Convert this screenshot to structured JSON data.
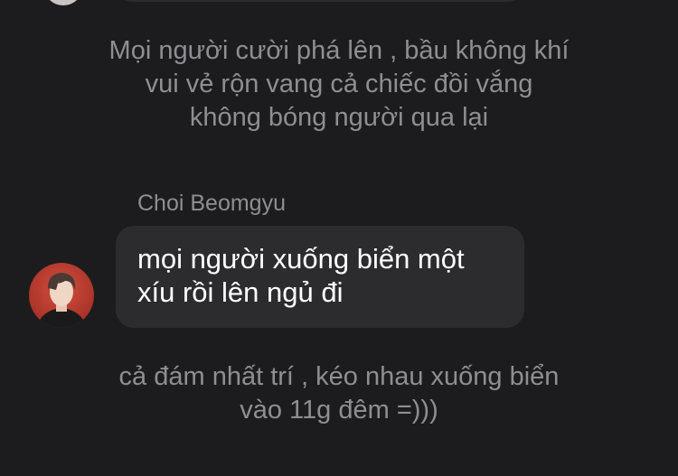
{
  "chat": {
    "narration_1": "Mọi người cười phá lên , bầu không khí\nvui vẻ rộn vang cả chiếc đồi vắng\nkhông bóng người qua lại",
    "message": {
      "sender": "Choi Beomgyu",
      "text": "mọi người xuống biển một\nxíu rồi lên ngủ đi"
    },
    "narration_2": "cả đám nhất trí , kéo nhau xuống biển\nvào 11g đêm =)))"
  },
  "colors": {
    "background": "#1c1c1e",
    "bubble": "#2c2c2e",
    "narration_text": "#8e8e93",
    "message_text": "#ffffff"
  }
}
